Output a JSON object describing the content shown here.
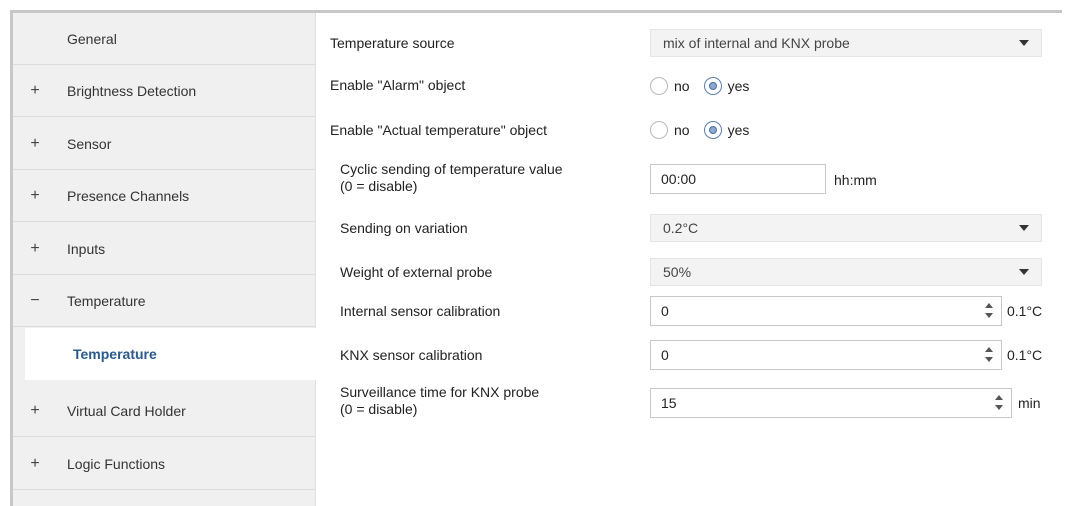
{
  "sidebar": {
    "items": [
      {
        "expander": "",
        "label": "General"
      },
      {
        "expander": "+",
        "label": "Brightness Detection"
      },
      {
        "expander": "+",
        "label": "Sensor"
      },
      {
        "expander": "+",
        "label": "Presence Channels"
      },
      {
        "expander": "+",
        "label": "Inputs"
      },
      {
        "expander": "−",
        "label": "Temperature"
      },
      {
        "expander": "",
        "label": "Temperature",
        "selected": true
      },
      {
        "expander": "+",
        "label": "Virtual Card Holder"
      },
      {
        "expander": "+",
        "label": "Logic Functions"
      }
    ]
  },
  "main": {
    "temperature_source": {
      "label": "Temperature source",
      "value": "mix of internal and KNX probe"
    },
    "alarm_object": {
      "label": "Enable \"Alarm\" object",
      "options": [
        "no",
        "yes"
      ],
      "selected": "yes"
    },
    "actual_temp_object": {
      "label": "Enable \"Actual temperature\" object",
      "options": [
        "no",
        "yes"
      ],
      "selected": "yes"
    },
    "cyclic_sending": {
      "label_line1": "Cyclic sending of temperature value",
      "label_line2": "(0 = disable)",
      "value": "00:00",
      "unit": "hh:mm"
    },
    "sending_on_variation": {
      "label": "Sending on variation",
      "value": "0.2°C"
    },
    "weight_external": {
      "label": "Weight of external probe",
      "value": "50%"
    },
    "internal_calibration": {
      "label": "Internal sensor calibration",
      "value": "0",
      "unit": "0.1°C"
    },
    "knx_calibration": {
      "label": "KNX sensor calibration",
      "value": "0",
      "unit": "0.1°C"
    },
    "surveillance_time": {
      "label_line1": "Surveillance time for KNX probe",
      "label_line2": "(0 = disable)",
      "value": "15",
      "unit": "min"
    }
  },
  "colors": {
    "selected_item_text": "#2a5a8a",
    "sidebar_bg": "#f0f0f0",
    "radio_accent": "#4a6fa5"
  }
}
